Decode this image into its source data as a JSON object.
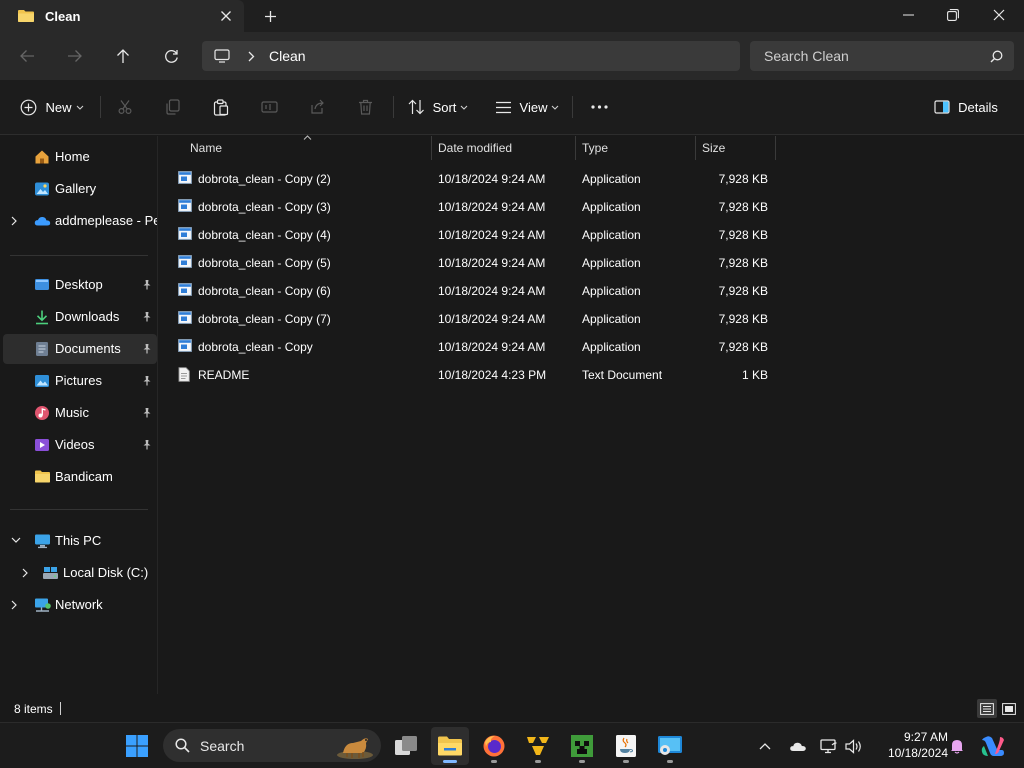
{
  "window": {
    "tab_title": "Clean",
    "icons": {
      "tab": "folder-icon",
      "close_tab": "close-icon",
      "new_tab": "plus-icon",
      "minimize": "minimize-icon",
      "maximize": "restore-icon",
      "close": "close-icon"
    }
  },
  "navbar": {
    "breadcrumb": [
      "Clean"
    ],
    "search_placeholder": "Search Clean",
    "icons": {
      "back": "arrow-left-icon",
      "forward": "arrow-right-icon",
      "up": "arrow-up-icon",
      "refresh": "refresh-icon",
      "computer": "monitor-icon",
      "separator": "chevron-right-icon",
      "search": "search-icon"
    }
  },
  "toolbar": {
    "new_label": "New",
    "sort_label": "Sort",
    "view_label": "View",
    "details_label": "Details",
    "icons": [
      "plus-circle-icon",
      "cut-icon",
      "copy-icon",
      "paste-icon",
      "rename-icon",
      "share-icon",
      "delete-icon",
      "sort-icon",
      "view-icon",
      "more-icon",
      "details-pane-icon"
    ]
  },
  "sidebar": {
    "items": [
      {
        "label": "Home",
        "icon": "home-icon",
        "pinned": false
      },
      {
        "label": "Gallery",
        "icon": "gallery-icon",
        "pinned": false
      },
      {
        "label": "addmeplease - Personal",
        "icon": "onedrive-icon",
        "pinned": false
      },
      {
        "label": "Desktop",
        "icon": "desktop-icon",
        "pinned": true
      },
      {
        "label": "Downloads",
        "icon": "download-icon",
        "pinned": true
      },
      {
        "label": "Documents",
        "icon": "documents-icon",
        "pinned": true,
        "selected": true
      },
      {
        "label": "Pictures",
        "icon": "pictures-icon",
        "pinned": true
      },
      {
        "label": "Music",
        "icon": "music-icon",
        "pinned": true
      },
      {
        "label": "Videos",
        "icon": "videos-icon",
        "pinned": true
      },
      {
        "label": "Bandicam",
        "icon": "folder-icon",
        "pinned": false
      },
      {
        "label": "This PC",
        "icon": "this-pc-icon",
        "pinned": false
      },
      {
        "label": "Local Disk (C:)",
        "icon": "drive-icon",
        "pinned": false
      },
      {
        "label": "Network",
        "icon": "network-icon",
        "pinned": false
      }
    ]
  },
  "file_list": {
    "columns": [
      "Name",
      "Date modified",
      "Type",
      "Size"
    ],
    "rows": [
      {
        "name": "dobrota_clean - Copy (2)",
        "date": "10/18/2024 9:24 AM",
        "type": "Application",
        "size": "7,928 KB",
        "icon": "application-icon"
      },
      {
        "name": "dobrota_clean - Copy (3)",
        "date": "10/18/2024 9:24 AM",
        "type": "Application",
        "size": "7,928 KB",
        "icon": "application-icon"
      },
      {
        "name": "dobrota_clean - Copy (4)",
        "date": "10/18/2024 9:24 AM",
        "type": "Application",
        "size": "7,928 KB",
        "icon": "application-icon"
      },
      {
        "name": "dobrota_clean - Copy (5)",
        "date": "10/18/2024 9:24 AM",
        "type": "Application",
        "size": "7,928 KB",
        "icon": "application-icon"
      },
      {
        "name": "dobrota_clean - Copy (6)",
        "date": "10/18/2024 9:24 AM",
        "type": "Application",
        "size": "7,928 KB",
        "icon": "application-icon"
      },
      {
        "name": "dobrota_clean - Copy (7)",
        "date": "10/18/2024 9:24 AM",
        "type": "Application",
        "size": "7,928 KB",
        "icon": "application-icon"
      },
      {
        "name": "dobrota_clean - Copy",
        "date": "10/18/2024 9:24 AM",
        "type": "Application",
        "size": "7,928 KB",
        "icon": "application-icon"
      },
      {
        "name": "README",
        "date": "10/18/2024 4:23 PM",
        "type": "Text Document",
        "size": "1 KB",
        "icon": "text-document-icon"
      }
    ]
  },
  "status": {
    "item_count": "8 items",
    "icons": [
      "details-view-icon",
      "tiles-view-icon"
    ]
  },
  "taskbar": {
    "search_label": "Search",
    "time": "9:27 AM",
    "date": "10/18/2024",
    "apps": [
      "windows-start-icon",
      "task-view-icon",
      "file-explorer-icon",
      "firefox-icon",
      "app-icon",
      "minecraft-icon",
      "java-icon",
      "app-icon"
    ],
    "tray_icons": [
      "chevron-up-icon",
      "onedrive-icon",
      "network-icon",
      "volume-icon",
      "notification-bell-icon",
      "copilot-icon"
    ]
  },
  "colors": {
    "window_bg": "#191919",
    "selected_item": "#2d2d2d",
    "accent": "#4cc2ff",
    "folder": "#f0c44d"
  }
}
